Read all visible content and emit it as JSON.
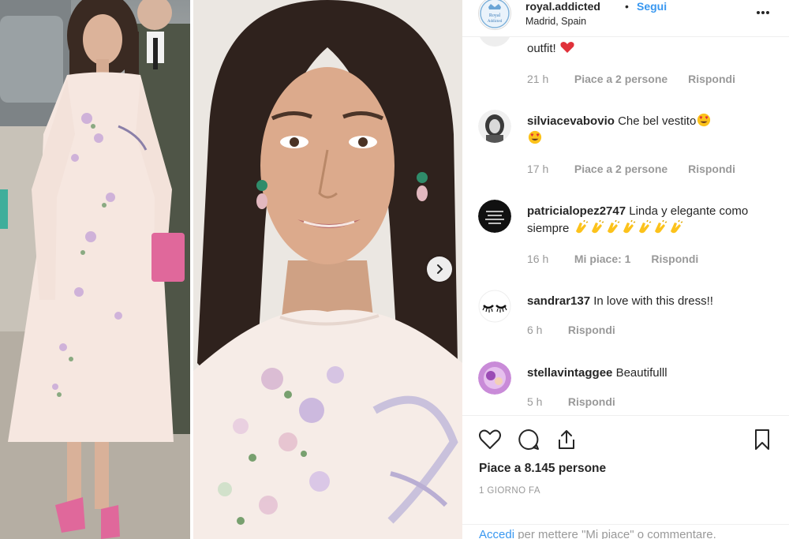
{
  "post": {
    "username": "royal.addicted",
    "separator": "•",
    "follow_label": "Segui",
    "location": "Madrid, Spain",
    "avatar_text": "Royal Addicted"
  },
  "comments": [
    {
      "user": "",
      "text": "outfit!",
      "time": "21 h",
      "likes": "Piace a 2 persone",
      "reply": "Rispondi",
      "icon": "heart-emoji"
    },
    {
      "user": "silviacevabovio",
      "text": "Che bel vestito",
      "time": "17 h",
      "likes": "Piace a 2 persone",
      "reply": "Rispondi",
      "icon": "heart-eyes-emoji"
    },
    {
      "user": "patricialopez2747",
      "text": "Linda y elegante como siempre",
      "time": "16 h",
      "likes": "Mi piace: 1",
      "reply": "Rispondi",
      "icon": "clapping-hands-emoji"
    },
    {
      "user": "sandrar137",
      "text": "In love with this dress!!",
      "time": "6 h",
      "likes": "",
      "reply": "Rispondi"
    },
    {
      "user": "stellavintaggee",
      "text": "Beautifulll",
      "time": "5 h",
      "likes": "",
      "reply": "Rispondi"
    }
  ],
  "actions": {
    "likes_text": "Piace a 8.145 persone",
    "date_text": "1 GIORNO FA",
    "login_link": "Accedi",
    "login_rest": " per mettere \"Mi piace\" o commentare."
  },
  "colors": {
    "link_blue": "#3897f0",
    "meta_gray": "#999999",
    "text": "#262626",
    "dress_pink": "#f6e7e0",
    "clutch_pink": "#e0689b"
  }
}
